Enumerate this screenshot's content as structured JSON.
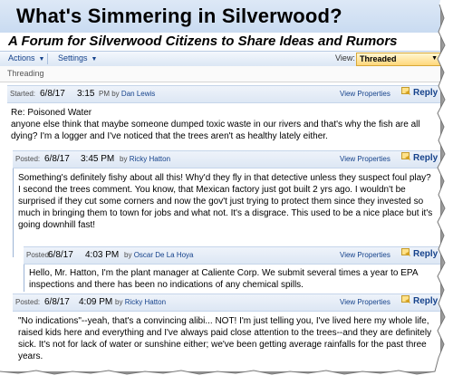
{
  "header": {
    "title": "What's Simmering in Silverwood?",
    "subtitle": "A Forum for Silverwood Citizens to Share Ideas and Rumors"
  },
  "toolbar": {
    "actions_label": "Actions",
    "settings_label": "Settings",
    "view_label": "View:",
    "view_value": "Threaded"
  },
  "threading_label": "Threading",
  "common": {
    "by": "by",
    "view_properties": "View Properties",
    "reply": "Reply"
  },
  "posts": [
    {
      "label": "Started:",
      "date": "6/8/17",
      "time": "3:15",
      "ampm": "PM",
      "author": "Dan Lewis",
      "subject": "Re: Poisoned Water",
      "body": "anyone else think that maybe someone dumped toxic waste in our rivers and that's why the fish are all dying? I'm a logger and I've noticed that the trees aren't as healthy lately either."
    },
    {
      "label": "Posted:",
      "date": "6/8/17",
      "time": "3:45 PM",
      "author": "Ricky Hatton",
      "body": "Something's definitely fishy about all this! Why'd they fly in that detective unless they suspect foul play? I second the trees comment. You know, that Mexican factory just got built 2 yrs ago. I wouldn't be surprised if they cut some corners and now the gov't just trying to protect them since they invested so much in bringing them to town for jobs and what not. It's a disgrace. This used to be a nice place but it's going downhill fast!"
    },
    {
      "label": "Posted:",
      "date": "6/8/17",
      "time": "4:03 PM",
      "author": "Oscar De La Hoya",
      "body": "Hello, Mr. Hatton, I'm the plant manager at Caliente Corp. We submit several times a year to EPA inspections and there has been no indications of any chemical spills."
    },
    {
      "label": "Posted:",
      "date": "6/8/17",
      "time": "4:09 PM",
      "author": "Ricky Hatton",
      "body": "\"No indications\"--yeah, that's a convincing alibi... NOT! I'm just telling you, I've lived here my whole life, raised kids here and everything and I've always paid close attention to the trees--and they are definitely sick. It's not for lack of water or sunshine either; we've been getting average rainfalls for the past three years."
    }
  ],
  "colors": {
    "title_bg": "#c9dbf1",
    "toolbar_text": "#15428b",
    "view_select_bg": "#ffd77a"
  }
}
